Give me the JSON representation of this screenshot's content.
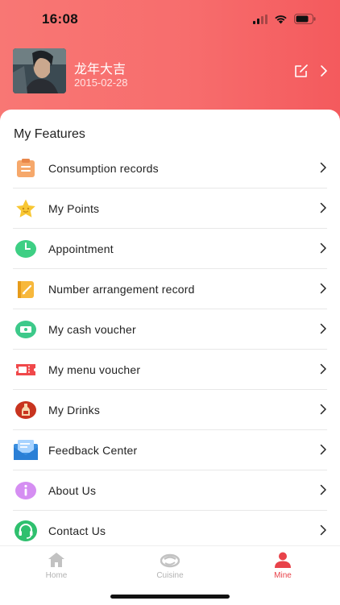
{
  "status_bar": {
    "time": "16:08"
  },
  "profile": {
    "name": "龙年大吉",
    "date": "2015-02-28"
  },
  "features": {
    "title": "My Features",
    "items": [
      {
        "label": "Consumption records",
        "icon": "clipboard-icon"
      },
      {
        "label": "My Points",
        "icon": "star-icon"
      },
      {
        "label": "Appointment",
        "icon": "clock-icon"
      },
      {
        "label": "Number arrangement record",
        "icon": "notepad-icon"
      },
      {
        "label": "My cash voucher",
        "icon": "cash-voucher-icon"
      },
      {
        "label": "My menu voucher",
        "icon": "ticket-icon"
      },
      {
        "label": "My Drinks",
        "icon": "bottle-icon"
      },
      {
        "label": "Feedback Center",
        "icon": "mail-icon"
      },
      {
        "label": "About Us",
        "icon": "info-icon"
      },
      {
        "label": "Contact Us",
        "icon": "headset-icon"
      }
    ]
  },
  "tab_bar": {
    "tabs": [
      {
        "label": "Home",
        "icon": "home-icon",
        "active": false
      },
      {
        "label": "Cuisine",
        "icon": "dish-icon",
        "active": false
      },
      {
        "label": "Mine",
        "icon": "person-icon",
        "active": true
      }
    ]
  },
  "colors": {
    "header_gradient_start": "#f87774",
    "header_gradient_end": "#f45a5d",
    "active_tab": "#e8434a"
  }
}
